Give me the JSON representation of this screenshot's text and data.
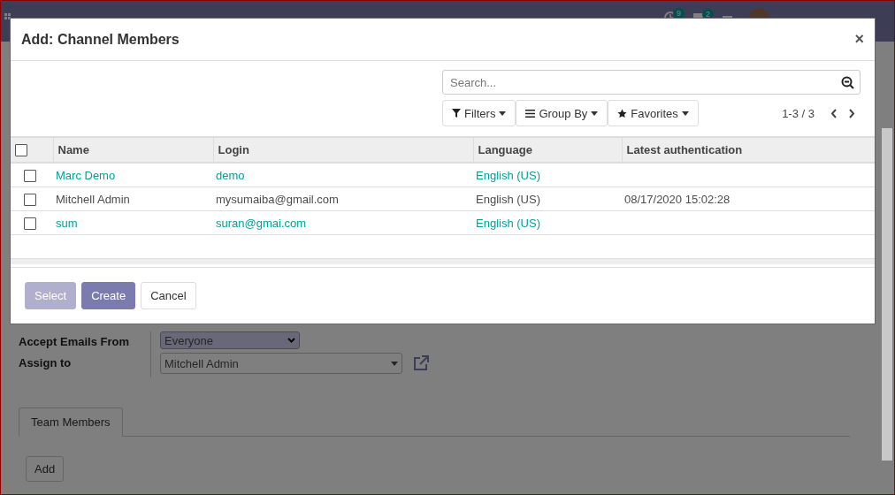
{
  "navbar": {
    "activity_count": "9",
    "message_count": "2"
  },
  "form": {
    "fields": [
      {
        "label": "Accept Emails From",
        "kind": "select",
        "value": "Everyone"
      },
      {
        "label": "Assign to",
        "kind": "many2one",
        "value": "Mitchell Admin"
      }
    ],
    "tabs": [
      {
        "label": "Team Members",
        "selected": true
      }
    ],
    "add_button": "Add"
  },
  "dialog": {
    "title": "Add: Channel Members",
    "close": "×",
    "search": {
      "placeholder": "Search..."
    },
    "filters": [
      {
        "label": "Filters",
        "kind": "filter"
      },
      {
        "label": "Group By",
        "kind": "group"
      },
      {
        "label": "Favorites",
        "kind": "star"
      }
    ],
    "pager": "1-3 / 3",
    "table": {
      "select_all": false,
      "columns": [
        "Name",
        "Login",
        "Language",
        "Latest authentication"
      ],
      "rows": [
        {
          "checked": false,
          "active": true,
          "cells": [
            "Marc Demo",
            "demo",
            "English (US)",
            ""
          ]
        },
        {
          "checked": false,
          "active": false,
          "cells": [
            "Mitchell Admin",
            "mysumaiba@gmail.com",
            "English (US)",
            "08/17/2020 15:02:28"
          ]
        },
        {
          "checked": false,
          "active": true,
          "cells": [
            "sum",
            "suran@gmai.com",
            "English (US)",
            ""
          ]
        }
      ]
    },
    "buttons": [
      {
        "label": "Select",
        "kind": "primary",
        "disabled": true
      },
      {
        "label": "Create",
        "kind": "primary",
        "disabled": false
      },
      {
        "label": "Cancel",
        "kind": "secondary",
        "disabled": false
      }
    ]
  }
}
